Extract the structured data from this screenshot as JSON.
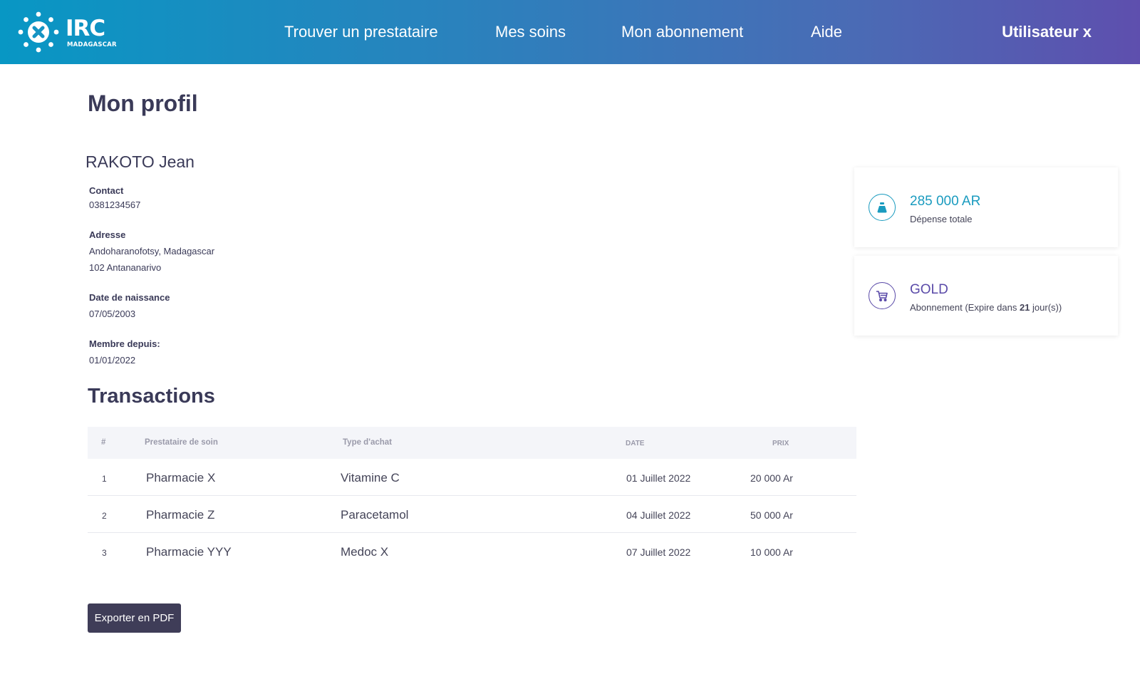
{
  "header": {
    "logo_text": "IRC",
    "logo_subtitle": "MADAGASCAR",
    "nav": [
      {
        "label": "Trouver un prestataire"
      },
      {
        "label": "Mes soins"
      },
      {
        "label": "Mon abonnement"
      },
      {
        "label": "Aide"
      }
    ],
    "user_label": "Utilisateur x"
  },
  "profile": {
    "title": "Mon profil",
    "name": "RAKOTO Jean",
    "contact_label": "Contact",
    "contact_value": "0381234567",
    "address_label": "Adresse",
    "address_line1": "Andoharanofotsy, Madagascar",
    "address_line2": "102 Antananarivo",
    "birthdate_label": "Date de naissance",
    "birthdate_value": "07/05/2003",
    "member_since_label": "Membre depuis:",
    "member_since_value": "01/01/2022"
  },
  "transactions": {
    "title": "Transactions",
    "columns": [
      "#",
      "Prestataire de soin",
      "Type d'achat",
      "DATE",
      "PRIX"
    ],
    "rows": [
      {
        "index": "1",
        "provider": "Pharmacie X",
        "type": "Vitamine C",
        "date": "01 Juillet 2022",
        "price": "20 000 Ar"
      },
      {
        "index": "2",
        "provider": "Pharmacie Z",
        "type": "Paracetamol",
        "date": "04 Juillet 2022",
        "price": "50 000 Ar"
      },
      {
        "index": "3",
        "provider": "Pharmacie YYY",
        "type": "Medoc X",
        "date": "07 Juillet 2022",
        "price": "10 000 Ar"
      }
    ],
    "export_label": "Exporter en PDF"
  },
  "stats": {
    "spending": {
      "value": "285 000 AR",
      "label": "Dépense totale",
      "color": "#1a9bbf",
      "icon": "money-bag-icon"
    },
    "subscription": {
      "value": "GOLD",
      "label_prefix": "Abonnement (Expire dans ",
      "days": "21",
      "label_suffix": " jour(s))",
      "color": "#5a4aa8",
      "icon": "cart-icon"
    }
  }
}
